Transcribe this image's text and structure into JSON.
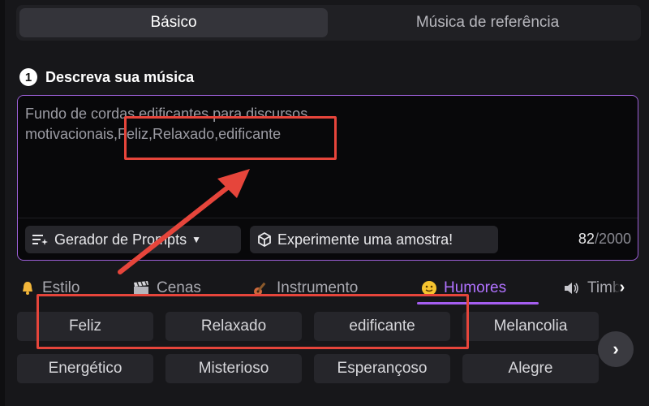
{
  "tabs": [
    {
      "label": "Básico",
      "active": true
    },
    {
      "label": "Música de referência",
      "active": false
    }
  ],
  "section": {
    "number": "1",
    "title": "Descreva sua música"
  },
  "prompt": {
    "value": "Fundo de cordas edificantes para discursos\nmotivacionais,Feliz,Relaxado,edificante",
    "counter_current": "82",
    "counter_max": "/2000"
  },
  "tools": {
    "generator_label": "Gerador de Prompts",
    "sample_label": "Experimente uma amostra!"
  },
  "categories": [
    {
      "label": "Estilo",
      "icon": "bell-icon",
      "active": false
    },
    {
      "label": "Cenas",
      "icon": "clapperboard-icon",
      "active": false
    },
    {
      "label": "Instrumento",
      "icon": "guitar-icon",
      "active": false
    },
    {
      "label": "Humores",
      "icon": "smiley-icon",
      "active": true
    },
    {
      "label": "Timbre",
      "icon": "speaker-icon",
      "active": false
    }
  ],
  "tags_row1": [
    "Feliz",
    "Relaxado",
    "edificante",
    "Melancolia"
  ],
  "tags_row2": [
    "Energético",
    "Misterioso",
    "Esperançoso",
    "Alegre"
  ],
  "colors": {
    "accent": "#a55ef0",
    "annotation": "#e6453b",
    "background": "#17171a"
  }
}
